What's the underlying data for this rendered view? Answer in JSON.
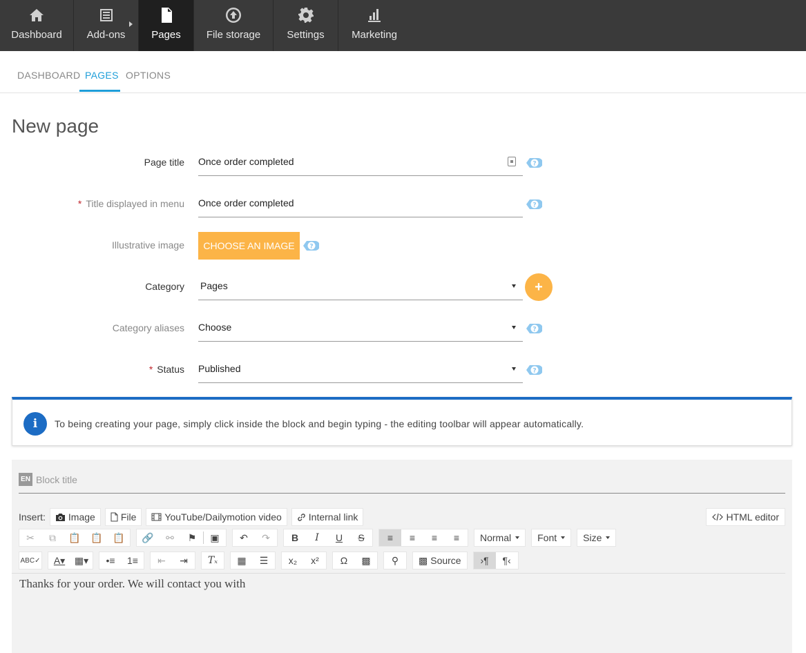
{
  "topnav": {
    "items": [
      {
        "label": "Dashboard",
        "icon": "home-icon"
      },
      {
        "label": "Add-ons",
        "icon": "list-icon"
      },
      {
        "label": "Pages",
        "icon": "page-icon"
      },
      {
        "label": "File storage",
        "icon": "upload-icon"
      },
      {
        "label": "Settings",
        "icon": "gear-icon"
      },
      {
        "label": "Marketing",
        "icon": "bar-chart-icon"
      }
    ],
    "active": "Pages"
  },
  "subtabs": {
    "items": [
      "DASHBOARD",
      "PAGES",
      "OPTIONS"
    ],
    "active": "PAGES"
  },
  "title": "New page",
  "form": {
    "page_title": {
      "label": "Page title",
      "value": "Once order completed"
    },
    "menu_title": {
      "label": "Title displayed in menu",
      "value": "Once order completed",
      "required_mark": "*"
    },
    "image": {
      "label": "Illustrative image",
      "button": "CHOOSE AN IMAGE"
    },
    "category": {
      "label": "Category",
      "value": "Pages",
      "add_label": "+"
    },
    "aliases": {
      "label": "Category aliases",
      "value": "Choose"
    },
    "status": {
      "label": "Status",
      "value": "Published",
      "required_mark": "*"
    }
  },
  "info": {
    "icon_text": "i",
    "text": "To being creating your page, simply click inside the block and begin typing - the editing toolbar will appear automatically."
  },
  "editor": {
    "lang_badge": "EN",
    "block_title_placeholder": "Block title",
    "insert_label": "Insert:",
    "insert_buttons": {
      "image": "Image",
      "file": "File",
      "video": "YouTube/Dailymotion video",
      "link": "Internal link"
    },
    "html_editor": "HTML editor",
    "format_combo": "Normal",
    "font_combo": "Font",
    "size_combo": "Size",
    "source": "Source",
    "content": "Thanks for your order. We will contact you with"
  },
  "colors": {
    "accent_blue": "#1e9ed9",
    "accent_orange": "#fcb447",
    "info_blue": "#1c6cc4",
    "required_red": "#c0272d"
  }
}
